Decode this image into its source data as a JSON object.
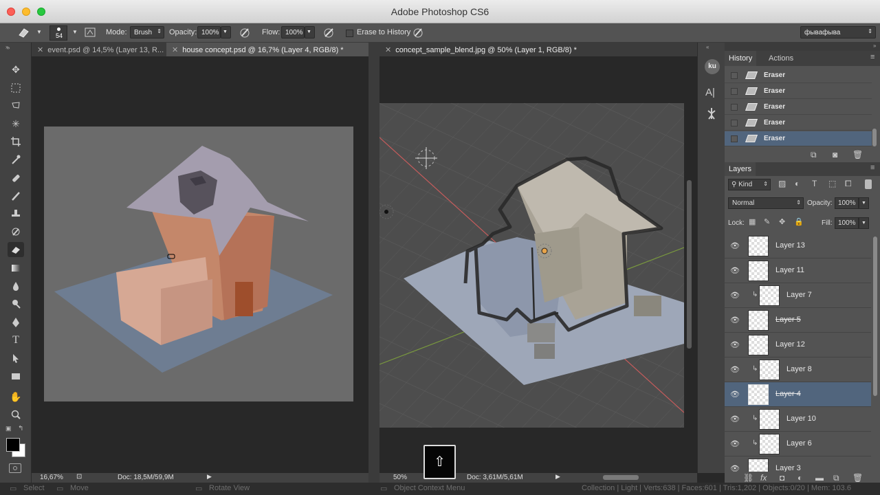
{
  "window": {
    "title": "Adobe Photoshop CS6"
  },
  "options": {
    "brush_size": "54",
    "mode_label": "Mode:",
    "mode_value": "Brush",
    "opacity_label": "Opacity:",
    "opacity_value": "100%",
    "flow_label": "Flow:",
    "flow_value": "100%",
    "erase_history_label": "Erase to History",
    "workspace_value": "фывафыва"
  },
  "documents": [
    {
      "tab": "event.psd @ 14,5% (Layer 13, R...",
      "active": false
    },
    {
      "tab": "house concept.psd @ 16,7% (Layer 4, RGB/8) *",
      "active": true
    },
    {
      "tab": "concept_sample_blend.jpg @ 50% (Layer 1, RGB/8) *",
      "active": false
    }
  ],
  "status_left": {
    "zoom": "16,67%",
    "doc": "Doc: 18,5M/59,9M"
  },
  "status_right": {
    "zoom": "50%",
    "doc": "Doc: 3,61M/5,61M"
  },
  "overlay": {
    "shift_key": "⇧"
  },
  "blender_bar": {
    "select": "Select",
    "move": "Move",
    "rotate": "Rotate View",
    "context": "Object Context Menu",
    "stats": "Collection | Light | Verts:638 | Faces:601 | Tris:1,202 | Objects:0/20 | Mem: 103.6"
  },
  "history": {
    "tabs": [
      "History",
      "Actions"
    ],
    "items": [
      {
        "label": "Eraser",
        "selected": false
      },
      {
        "label": "Eraser",
        "selected": false
      },
      {
        "label": "Eraser",
        "selected": false
      },
      {
        "label": "Eraser",
        "selected": false
      },
      {
        "label": "Eraser",
        "selected": true
      }
    ]
  },
  "layers": {
    "tab": "Layers",
    "kind_label": "Kind",
    "blend_mode": "Normal",
    "opacity_label": "Opacity:",
    "opacity_value": "100%",
    "lock_label": "Lock:",
    "fill_label": "Fill:",
    "fill_value": "100%",
    "items": [
      {
        "name": "Layer 13",
        "clipped": false,
        "selected": false
      },
      {
        "name": "Layer 11",
        "clipped": false,
        "selected": false
      },
      {
        "name": "Layer 7",
        "clipped": true,
        "selected": false
      },
      {
        "name": "Layer 5",
        "clipped": false,
        "selected": false
      },
      {
        "name": "Layer 12",
        "clipped": false,
        "selected": false
      },
      {
        "name": "Layer 8",
        "clipped": true,
        "selected": false
      },
      {
        "name": "Layer 4",
        "clipped": false,
        "selected": true
      },
      {
        "name": "Layer 10",
        "clipped": true,
        "selected": false
      },
      {
        "name": "Layer 6",
        "clipped": true,
        "selected": false
      },
      {
        "name": "Layer 3",
        "clipped": false,
        "selected": false
      }
    ]
  }
}
